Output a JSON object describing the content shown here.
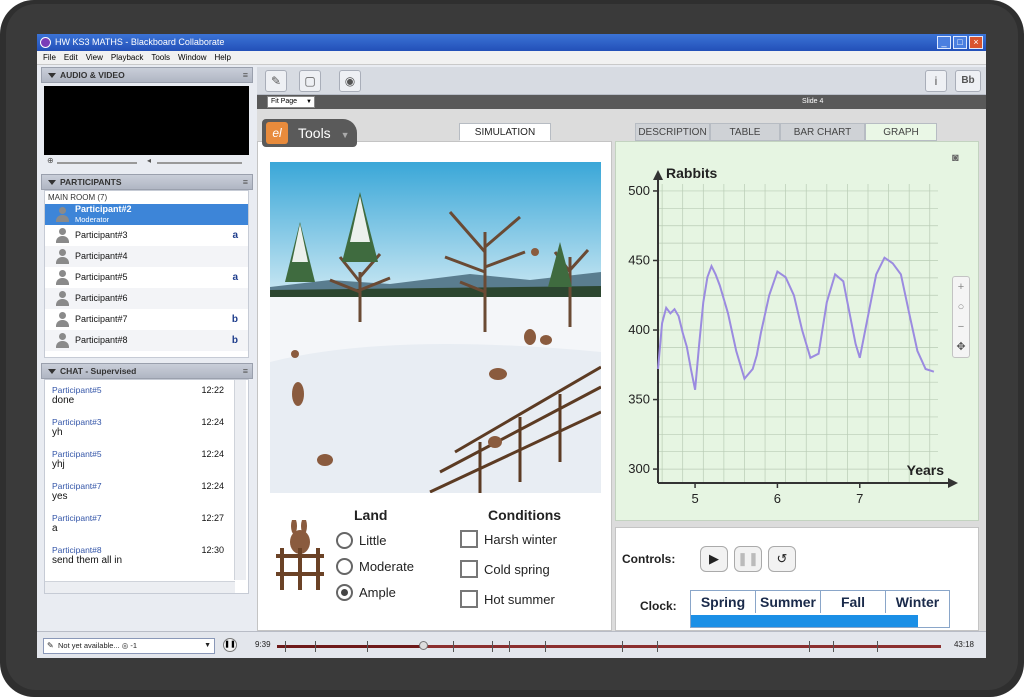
{
  "window": {
    "title": "HW KS3 MATHS - Blackboard Collaborate"
  },
  "menu": [
    "File",
    "Edit",
    "View",
    "Playback",
    "Tools",
    "Window",
    "Help"
  ],
  "audio_video": {
    "header": "AUDIO & VIDEO"
  },
  "participants": {
    "header": "PARTICIPANTS",
    "room": "MAIN ROOM  (7)",
    "list": [
      {
        "name": "Participant#2",
        "role": "Moderator",
        "badge": ""
      },
      {
        "name": "Participant#3",
        "role": "",
        "badge": "a"
      },
      {
        "name": "Participant#4",
        "role": "",
        "badge": ""
      },
      {
        "name": "Participant#5",
        "role": "",
        "badge": "a"
      },
      {
        "name": "Participant#6",
        "role": "",
        "badge": ""
      },
      {
        "name": "Participant#7",
        "role": "",
        "badge": "b"
      },
      {
        "name": "Participant#8",
        "role": "",
        "badge": "b"
      }
    ]
  },
  "chat": {
    "header": "CHAT - Supervised",
    "messages": [
      {
        "from": "Participant#5",
        "time": "12:22",
        "text": "done"
      },
      {
        "from": "Participant#3",
        "time": "12:24",
        "text": "yh"
      },
      {
        "from": "Participant#5",
        "time": "12:24",
        "text": "yhj"
      },
      {
        "from": "Participant#7",
        "time": "12:24",
        "text": "yes"
      },
      {
        "from": "Participant#7",
        "time": "12:27",
        "text": "a"
      },
      {
        "from": "Participant#8",
        "time": "12:30",
        "text": "send them all in"
      }
    ]
  },
  "toolbar": {
    "fit_page": "Fit Page",
    "slide": "Slide 4"
  },
  "simulation": {
    "tools_label": "Tools",
    "tabs": [
      "SIMULATION",
      "DESCRIPTION",
      "TABLE",
      "BAR CHART",
      "GRAPH"
    ],
    "land": {
      "title": "Land",
      "options": [
        "Little",
        "Moderate",
        "Ample"
      ],
      "selected": "Ample"
    },
    "conditions": {
      "title": "Conditions",
      "options": [
        "Harsh winter",
        "Cold spring",
        "Hot summer"
      ]
    },
    "controls_label": "Controls:",
    "clock_label": "Clock:",
    "seasons": [
      "Spring",
      "Summer",
      "Fall",
      "Winter"
    ],
    "clock_progress": 0.88
  },
  "chart_data": {
    "type": "line",
    "title": "",
    "xlabel": "Years",
    "ylabel": "Rabbits",
    "xlim": [
      4.55,
      7.95
    ],
    "ylim": [
      290,
      505
    ],
    "xticks": [
      5,
      6,
      7
    ],
    "yticks": [
      300,
      350,
      400,
      450,
      500
    ],
    "grid": true,
    "color": "#9b8be0",
    "series": [
      {
        "x": [
          4.55,
          4.6,
          4.65,
          4.7,
          4.75,
          4.8,
          4.85,
          4.9,
          4.95,
          5.0,
          5.05,
          5.1,
          5.15,
          5.2,
          5.25,
          5.3,
          5.4,
          5.5,
          5.6,
          5.7,
          5.75,
          5.8,
          5.9,
          6.0,
          6.1,
          6.2,
          6.3,
          6.4,
          6.5,
          6.6,
          6.7,
          6.8,
          6.9,
          6.95,
          7.0,
          7.1,
          7.2,
          7.3,
          7.4,
          7.5,
          7.6,
          7.7,
          7.8,
          7.9
        ],
        "y": [
          372,
          405,
          416,
          412,
          415,
          410,
          398,
          388,
          372,
          357,
          390,
          420,
          438,
          446,
          440,
          432,
          412,
          385,
          365,
          372,
          382,
          398,
          425,
          442,
          438,
          425,
          400,
          380,
          383,
          420,
          440,
          435,
          405,
          390,
          380,
          410,
          440,
          452,
          448,
          440,
          412,
          385,
          372,
          370
        ]
      }
    ]
  },
  "timeline": {
    "status": "Not yet available... ◎ -1",
    "start": "9:39",
    "end": "43:18",
    "progress": 0.22
  }
}
